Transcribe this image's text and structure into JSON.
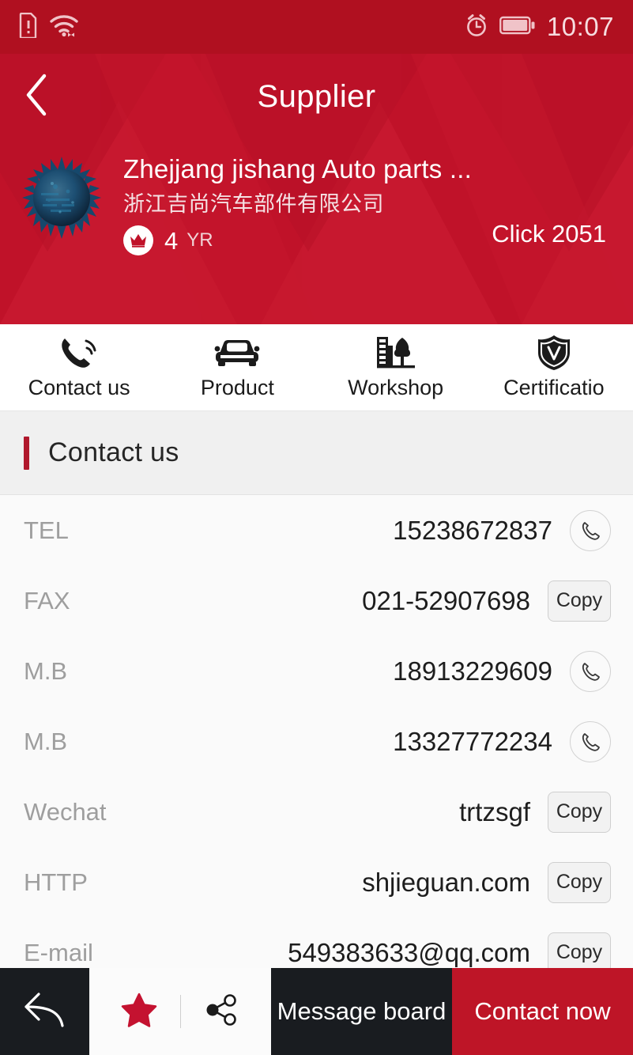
{
  "statusbar": {
    "time": "10:07",
    "icons": [
      "sim-alert-icon",
      "wifi-icon",
      "alarm-icon",
      "battery-icon"
    ]
  },
  "header": {
    "title": "Supplier",
    "back_icon": "chevron-left-icon",
    "background_color": "#c0122a"
  },
  "company": {
    "logo_icon": "company-logo-spiky-sphere",
    "name_en": "Zhejjang jishang Auto parts ...",
    "name_cn": "浙江吉尚汽车部件有限公司",
    "badge_icon": "crown-icon",
    "years": "4",
    "years_unit": "YR",
    "clicks": "Click 2051"
  },
  "tabs": [
    {
      "label": "Contact us",
      "icon": "phone-ring-icon"
    },
    {
      "label": "Product",
      "icon": "car-icon"
    },
    {
      "label": "Workshop",
      "icon": "factory-tree-icon"
    },
    {
      "label": "Certificatio",
      "icon": "shield-v-icon"
    }
  ],
  "section": {
    "title": "Contact us",
    "accent_color": "#b0182c"
  },
  "contacts": [
    {
      "label": "TEL",
      "value": "15238672837",
      "action": "call",
      "action_label": "",
      "action_icon": "phone-icon"
    },
    {
      "label": "FAX",
      "value": "021-52907698",
      "action": "copy",
      "action_label": "Copy",
      "action_icon": ""
    },
    {
      "label": "M.B",
      "value": "18913229609",
      "action": "call",
      "action_label": "",
      "action_icon": "phone-icon"
    },
    {
      "label": "M.B",
      "value": "13327772234",
      "action": "call",
      "action_label": "",
      "action_icon": "phone-icon"
    },
    {
      "label": "Wechat",
      "value": "trtzsgf",
      "action": "copy",
      "action_label": "Copy",
      "action_icon": ""
    },
    {
      "label": "HTTP",
      "value": "shjieguan.com",
      "action": "copy",
      "action_label": "Copy",
      "action_icon": ""
    },
    {
      "label": "E-mail",
      "value": "549383633@qq.com",
      "action": "copy",
      "action_label": "Copy",
      "action_icon": ""
    }
  ],
  "bottombar": {
    "back_icon": "reply-arrow-icon",
    "favorite_icon": "star-icon",
    "share_icon": "share-nodes-icon",
    "message_label": "Message board",
    "contact_label": "Contact now",
    "contact_color": "#be1527",
    "dark_color": "#191c20"
  }
}
